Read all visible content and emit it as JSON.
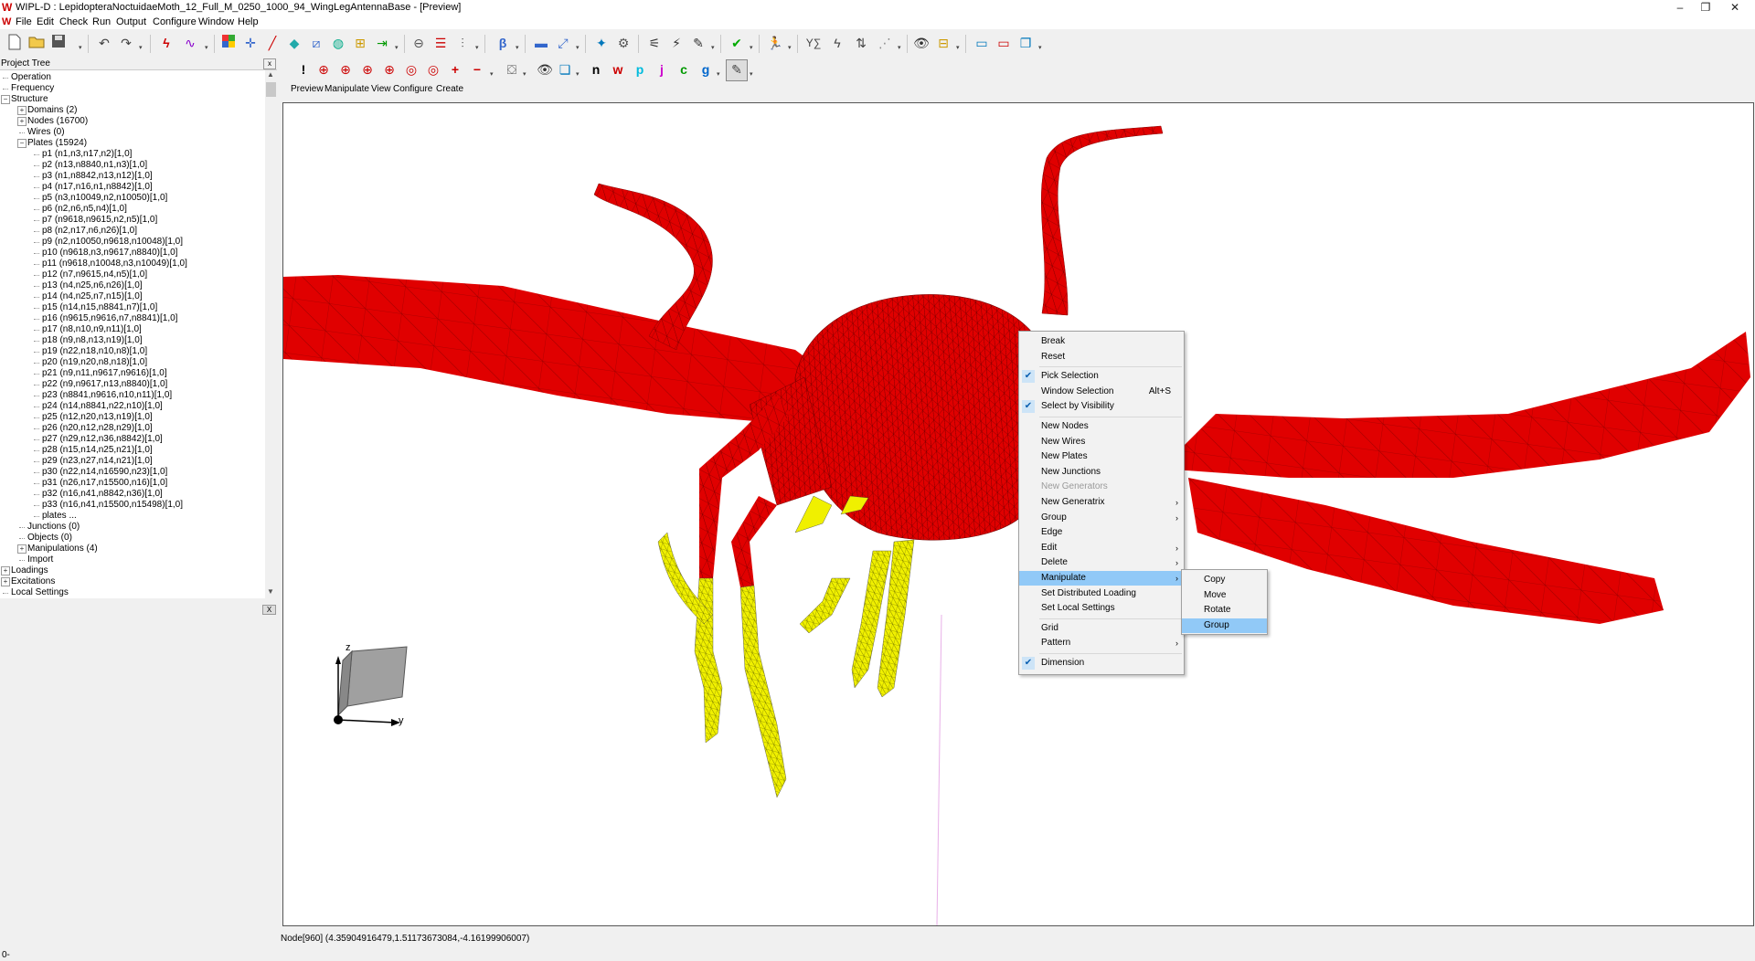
{
  "window": {
    "title": "WIPL-D : LepidopteraNoctuidaeMoth_12_Full_M_0250_1000_94_WingLegAntennaBase - [Preview]",
    "app_icon": "W",
    "controls": {
      "minimize": "–",
      "restore": "❐",
      "close": "✕"
    }
  },
  "menubar": [
    "File",
    "Edit",
    "Check",
    "Run",
    "Output",
    "Configure",
    "Window",
    "Help"
  ],
  "toolbar": {
    "main_letters": [
      "β",
      "Y",
      "∑"
    ],
    "secondary_letters": [
      "!",
      "n",
      "w",
      "p",
      "j",
      "c",
      "g"
    ]
  },
  "project_tree": {
    "header": "Project Tree",
    "close": "x",
    "items": [
      {
        "label": "Operation",
        "level": 0,
        "expander": ""
      },
      {
        "label": "Frequency",
        "level": 0,
        "expander": ""
      },
      {
        "label": "Structure",
        "level": 0,
        "expander": "−"
      },
      {
        "label": "Domains (2)",
        "level": 1,
        "expander": "+"
      },
      {
        "label": "Nodes (16700)",
        "level": 1,
        "expander": "+"
      },
      {
        "label": "Wires (0)",
        "level": 1,
        "expander": ""
      },
      {
        "label": "Plates (15924)",
        "level": 1,
        "expander": "−"
      },
      {
        "label": "p1 (n1,n3,n17,n2)[1,0]",
        "level": 2,
        "expander": ""
      },
      {
        "label": "p2 (n13,n8840,n1,n3)[1,0]",
        "level": 2,
        "expander": ""
      },
      {
        "label": "p3 (n1,n8842,n13,n12)[1,0]",
        "level": 2,
        "expander": ""
      },
      {
        "label": "p4 (n17,n16,n1,n8842)[1,0]",
        "level": 2,
        "expander": ""
      },
      {
        "label": "p5 (n3,n10049,n2,n10050)[1,0]",
        "level": 2,
        "expander": ""
      },
      {
        "label": "p6 (n2,n6,n5,n4)[1,0]",
        "level": 2,
        "expander": ""
      },
      {
        "label": "p7 (n9618,n9615,n2,n5)[1,0]",
        "level": 2,
        "expander": ""
      },
      {
        "label": "p8 (n2,n17,n6,n26)[1,0]",
        "level": 2,
        "expander": ""
      },
      {
        "label": "p9 (n2,n10050,n9618,n10048)[1,0]",
        "level": 2,
        "expander": ""
      },
      {
        "label": "p10 (n9618,n3,n9617,n8840)[1,0]",
        "level": 2,
        "expander": ""
      },
      {
        "label": "p11 (n9618,n10048,n3,n10049)[1,0]",
        "level": 2,
        "expander": ""
      },
      {
        "label": "p12 (n7,n9615,n4,n5)[1,0]",
        "level": 2,
        "expander": ""
      },
      {
        "label": "p13 (n4,n25,n6,n26)[1,0]",
        "level": 2,
        "expander": ""
      },
      {
        "label": "p14 (n4,n25,n7,n15)[1,0]",
        "level": 2,
        "expander": ""
      },
      {
        "label": "p15 (n14,n15,n8841,n7)[1,0]",
        "level": 2,
        "expander": ""
      },
      {
        "label": "p16 (n9615,n9616,n7,n8841)[1,0]",
        "level": 2,
        "expander": ""
      },
      {
        "label": "p17 (n8,n10,n9,n11)[1,0]",
        "level": 2,
        "expander": ""
      },
      {
        "label": "p18 (n9,n8,n13,n19)[1,0]",
        "level": 2,
        "expander": ""
      },
      {
        "label": "p19 (n22,n18,n10,n8)[1,0]",
        "level": 2,
        "expander": ""
      },
      {
        "label": "p20 (n19,n20,n8,n18)[1,0]",
        "level": 2,
        "expander": ""
      },
      {
        "label": "p21 (n9,n11,n9617,n9616)[1,0]",
        "level": 2,
        "expander": ""
      },
      {
        "label": "p22 (n9,n9617,n13,n8840)[1,0]",
        "level": 2,
        "expander": ""
      },
      {
        "label": "p23 (n8841,n9616,n10,n11)[1,0]",
        "level": 2,
        "expander": ""
      },
      {
        "label": "p24 (n14,n8841,n22,n10)[1,0]",
        "level": 2,
        "expander": ""
      },
      {
        "label": "p25 (n12,n20,n13,n19)[1,0]",
        "level": 2,
        "expander": ""
      },
      {
        "label": "p26 (n20,n12,n28,n29)[1,0]",
        "level": 2,
        "expander": ""
      },
      {
        "label": "p27 (n29,n12,n36,n8842)[1,0]",
        "level": 2,
        "expander": ""
      },
      {
        "label": "p28 (n15,n14,n25,n21)[1,0]",
        "level": 2,
        "expander": ""
      },
      {
        "label": "p29 (n23,n27,n14,n21)[1,0]",
        "level": 2,
        "expander": ""
      },
      {
        "label": "p30 (n22,n14,n16590,n23)[1,0]",
        "level": 2,
        "expander": ""
      },
      {
        "label": "p31 (n26,n17,n15500,n16)[1,0]",
        "level": 2,
        "expander": ""
      },
      {
        "label": "p32 (n16,n41,n8842,n36)[1,0]",
        "level": 2,
        "expander": ""
      },
      {
        "label": "p33 (n16,n41,n15500,n15498)[1,0]",
        "level": 2,
        "expander": ""
      },
      {
        "label": "plates ...",
        "level": 2,
        "expander": ""
      },
      {
        "label": "Junctions (0)",
        "level": 1,
        "expander": ""
      },
      {
        "label": "Objects (0)",
        "level": 1,
        "expander": ""
      },
      {
        "label": "Manipulations (4)",
        "level": 1,
        "expander": "+"
      },
      {
        "label": "Import",
        "level": 1,
        "expander": ""
      },
      {
        "label": "Loadings",
        "level": 0,
        "expander": "+"
      },
      {
        "label": "Excitations",
        "level": 0,
        "expander": "+"
      },
      {
        "label": "Local Settings",
        "level": 0,
        "expander": ""
      }
    ]
  },
  "bottom_pane": {
    "close": "X"
  },
  "submenu": [
    "Preview",
    "Manipulate",
    "View",
    "Configure",
    "Create"
  ],
  "axes": {
    "z": "z",
    "y": "y"
  },
  "context_menu": {
    "items": [
      {
        "label": "Break"
      },
      {
        "label": "Reset"
      },
      {
        "sep": true
      },
      {
        "label": "Pick Selection",
        "checked": true
      },
      {
        "label": "Window Selection",
        "shortcut": "Alt+S"
      },
      {
        "label": "Select by Visibility",
        "checked": true
      },
      {
        "sep": true
      },
      {
        "label": "New Nodes"
      },
      {
        "label": "New Wires"
      },
      {
        "label": "New Plates"
      },
      {
        "label": "New Junctions"
      },
      {
        "label": "New Generators",
        "disabled": true
      },
      {
        "label": "New Generatrix",
        "submenu": true
      },
      {
        "label": "Group",
        "submenu": true
      },
      {
        "label": "Edge"
      },
      {
        "label": "Edit",
        "submenu": true
      },
      {
        "label": "Delete",
        "submenu": true
      },
      {
        "label": "Manipulate",
        "submenu": true,
        "highlight": true
      },
      {
        "label": "Set Distributed Loading"
      },
      {
        "label": "Set Local Settings"
      },
      {
        "sep": true
      },
      {
        "label": "Grid"
      },
      {
        "label": "Pattern",
        "submenu": true
      },
      {
        "sep": true
      },
      {
        "label": "Dimension",
        "checked": true
      }
    ]
  },
  "manipulate_submenu": {
    "items": [
      {
        "label": "Copy"
      },
      {
        "label": "Move"
      },
      {
        "label": "Rotate"
      },
      {
        "label": "Group",
        "highlight": true
      }
    ]
  },
  "status": {
    "node_readout": "Node[960] (4.35904916479,1.51173673084,-4.16199906007)",
    "bottom": "0-"
  },
  "colors": {
    "body": "#e00000",
    "legs": "#f0f000",
    "mesh": "#000000",
    "highlight": "#91c9f7"
  }
}
